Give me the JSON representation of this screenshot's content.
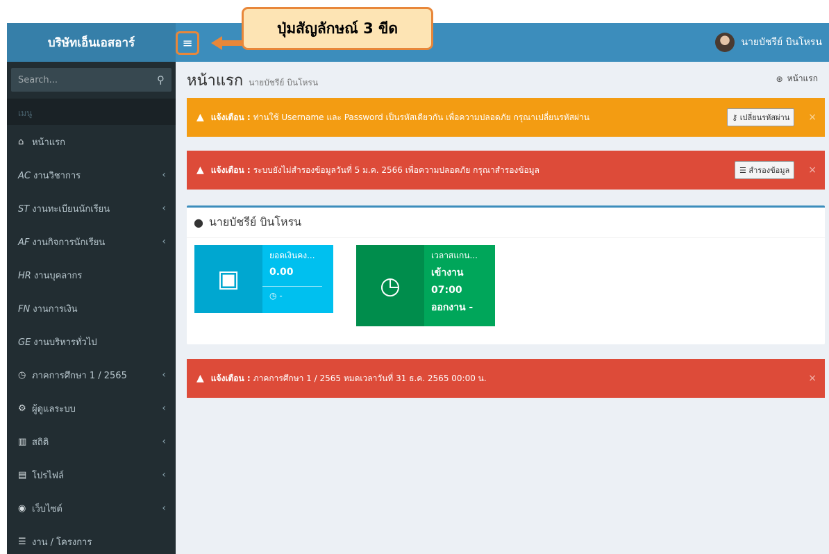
{
  "brand": "บริษัทเอ็นเอสอาร์",
  "menu_button_glyph": "≡",
  "callout": "ปุ่มสัญลักษณ์ 3 ขีด",
  "user_name": "นายบัชรีย์ บินโหรน",
  "search": {
    "placeholder": "Search..."
  },
  "menu_header": "เมนู",
  "nav": [
    {
      "icon": "home-icon",
      "glyph": "⌂",
      "code": "",
      "label": "หน้าแรก",
      "chevron": false
    },
    {
      "icon": "",
      "glyph": "",
      "code": "AC",
      "label": "งานวิชาการ",
      "chevron": true
    },
    {
      "icon": "",
      "glyph": "",
      "code": "ST",
      "label": "งานทะเบียนนักเรียน",
      "chevron": true
    },
    {
      "icon": "",
      "glyph": "",
      "code": "AF",
      "label": "งานกิจการนักเรียน",
      "chevron": true
    },
    {
      "icon": "",
      "glyph": "",
      "code": "HR",
      "label": "งานบุคลากร",
      "chevron": false
    },
    {
      "icon": "",
      "glyph": "",
      "code": "FN",
      "label": "งานการเงิน",
      "chevron": false
    },
    {
      "icon": "",
      "glyph": "",
      "code": "GE",
      "label": "งานบริหารทั่วไป",
      "chevron": false
    },
    {
      "icon": "clock-icon",
      "glyph": "◷",
      "code": "",
      "label": "ภาคการศึกษา 1 / 2565",
      "chevron": true
    },
    {
      "icon": "cogs-icon",
      "glyph": "⚙",
      "code": "",
      "label": "ผู้ดูแลระบบ",
      "chevron": true
    },
    {
      "icon": "bar-chart-icon",
      "glyph": "▥",
      "code": "",
      "label": "สถิติ",
      "chevron": true
    },
    {
      "icon": "file-icon",
      "glyph": "▤",
      "code": "",
      "label": "โปรไฟล์",
      "chevron": true
    },
    {
      "icon": "globe-icon",
      "glyph": "◉",
      "code": "",
      "label": "เว็บไซต์",
      "chevron": true
    },
    {
      "icon": "list-icon",
      "glyph": "☰",
      "code": "",
      "label": "งาน / โครงการ",
      "chevron": false
    }
  ],
  "page": {
    "title": "หน้าแรก",
    "subtitle": "นายบัชรีย์ บินโหรน",
    "breadcrumb": "หน้าแรก"
  },
  "alerts": {
    "password": {
      "label": "แจ้งเตือน :",
      "message": "ท่านใช้ Username และ Password เป็นรหัสเดียวกัน เพื่อความปลอดภัย กรุณาเปลี่ยนรหัสผ่าน",
      "button": "เปลี่ยนรหัสผ่าน"
    },
    "backup": {
      "label": "แจ้งเตือน :",
      "message": "ระบบยังไม่สำรองข้อมูลวันที่ 5 ม.ค. 2566 เพื่อความปลอดภัย กรุณาสำรองข้อมูล",
      "button": "สำรองข้อมูล"
    },
    "semester": {
      "label": "แจ้งเตือน :",
      "message": "ภาคการศึกษา 1 / 2565 หมดเวลาวันที่ 31 ธ.ค. 2565 00:00 น."
    }
  },
  "profile_box": {
    "title": "นายบัชรีย์ บินโหรน",
    "balance": {
      "label": "ยอดเงินคง...",
      "value": "0.00",
      "footer": "-"
    },
    "timecard": {
      "label": "เวลาสแกน...",
      "in": "เข้างาน",
      "time": "07:00",
      "out": "ออกงาน -"
    }
  },
  "colors": {
    "header": "#3c8dbc",
    "sidebar": "#222d32",
    "orange_alert": "#f39c12",
    "red_alert": "#dd4b39",
    "aqua": "#00c0ef",
    "green": "#00a65a",
    "callout_border": "#e8873a"
  }
}
